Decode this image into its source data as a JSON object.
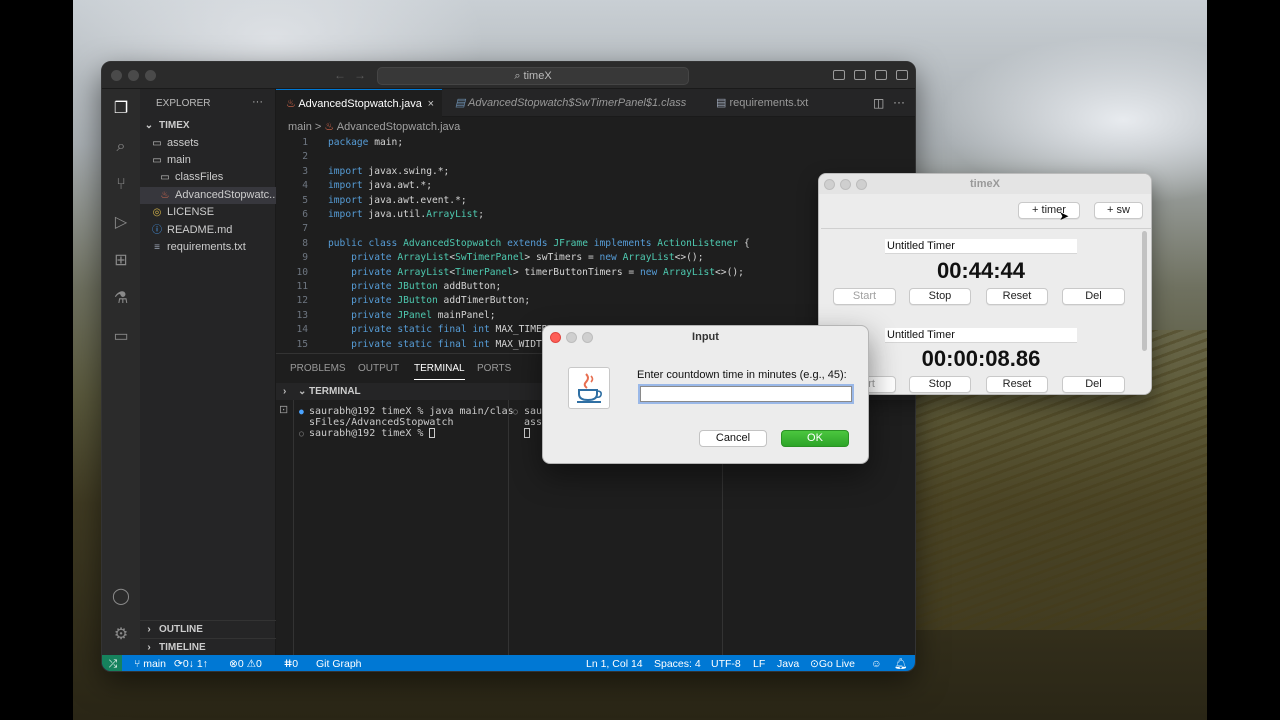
{
  "vscode": {
    "command_center": "timeX",
    "explorer": {
      "title": "EXPLORER",
      "more": "···",
      "project": "TIMEX",
      "items": [
        {
          "label": "assets",
          "icon": "folder-icon"
        },
        {
          "label": "main",
          "icon": "folder-open-icon"
        },
        {
          "label": "classFiles",
          "icon": "folder-icon"
        },
        {
          "label": "AdvancedStopwatc...",
          "icon": "java-file-icon"
        },
        {
          "label": "LICENSE",
          "icon": "license-icon"
        },
        {
          "label": "README.md",
          "icon": "info-icon"
        },
        {
          "label": "requirements.txt",
          "icon": "text-file-icon"
        }
      ],
      "outline": "OUTLINE",
      "timeline": "TIMELINE"
    },
    "tabs": [
      {
        "label": "AdvancedStopwatch.java",
        "close": "×"
      },
      {
        "label": "AdvancedStopwatch$SwTimerPanel$1.class"
      },
      {
        "label": "requirements.txt"
      }
    ],
    "breadcrumb": {
      "root": "main",
      "sep": ">",
      "file": "AdvancedStopwatch.java"
    },
    "code_lines": [
      {
        "n": "1",
        "t": "package main;"
      },
      {
        "n": "2",
        "t": ""
      },
      {
        "n": "3",
        "t": "import javax.swing.*;"
      },
      {
        "n": "4",
        "t": "import java.awt.*;"
      },
      {
        "n": "5",
        "t": "import java.awt.event.*;"
      },
      {
        "n": "6",
        "t": "import java.util.ArrayList;"
      },
      {
        "n": "7",
        "t": ""
      },
      {
        "n": "8",
        "t": "public class AdvancedStopwatch extends JFrame implements ActionListener {"
      },
      {
        "n": "9",
        "t": "    private ArrayList<SwTimerPanel> swTimers = new ArrayList<>();"
      },
      {
        "n": "10",
        "t": "    private ArrayList<TimerPanel> timerButtonTimers = new ArrayList<>();"
      },
      {
        "n": "11",
        "t": "    private JButton addButton;"
      },
      {
        "n": "12",
        "t": "    private JButton addTimerButton;"
      },
      {
        "n": "13",
        "t": "    private JPanel mainPanel;"
      },
      {
        "n": "14",
        "t": "    private static final int MAX_TIMER_PANELS = 3;"
      },
      {
        "n": "15",
        "t": "    private static final int MAX_WIDTH"
      }
    ],
    "panel_tabs": [
      "PROBLEMS",
      "OUTPUT",
      "TERMINAL",
      "PORTS"
    ],
    "terminal_title": "TERMINAL",
    "terminal_left": [
      "saurabh@192 timeX % java main/clas",
      "sFiles/AdvancedStopwatch",
      "saurabh@192 timeX % "
    ],
    "terminal_right": [
      "sau",
      "ass",
      ""
    ],
    "status": {
      "branch": "main",
      "sync": "0↓ 1↑",
      "errors": "0",
      "warnings": "0",
      "ports": "0",
      "git_graph": "Git Graph",
      "position": "Ln 1, Col 14",
      "spaces": "Spaces: 4",
      "encoding": "UTF-8",
      "eol": "LF",
      "language": "Java",
      "golive": "Go Live"
    }
  },
  "timex": {
    "title": "timeX",
    "add_timer": "+ timer",
    "add_sw": "+ sw",
    "timers": [
      {
        "name": "Untitled Timer",
        "display": "00:44:44",
        "start": "Start",
        "stop": "Stop",
        "reset": "Reset",
        "del": "Del"
      },
      {
        "name": "Untitled Timer",
        "display": "00:00:08.86",
        "start": "rt",
        "stop": "Stop",
        "reset": "Reset",
        "del": "Del"
      }
    ]
  },
  "dialog": {
    "title": "Input",
    "message": "Enter countdown time in minutes (e.g., 45):",
    "input_value": "",
    "cancel": "Cancel",
    "ok": "OK"
  },
  "colors": {
    "statusbar": "#0078d4",
    "ok_button": "#2da428",
    "close_red": "#fe5f57"
  }
}
